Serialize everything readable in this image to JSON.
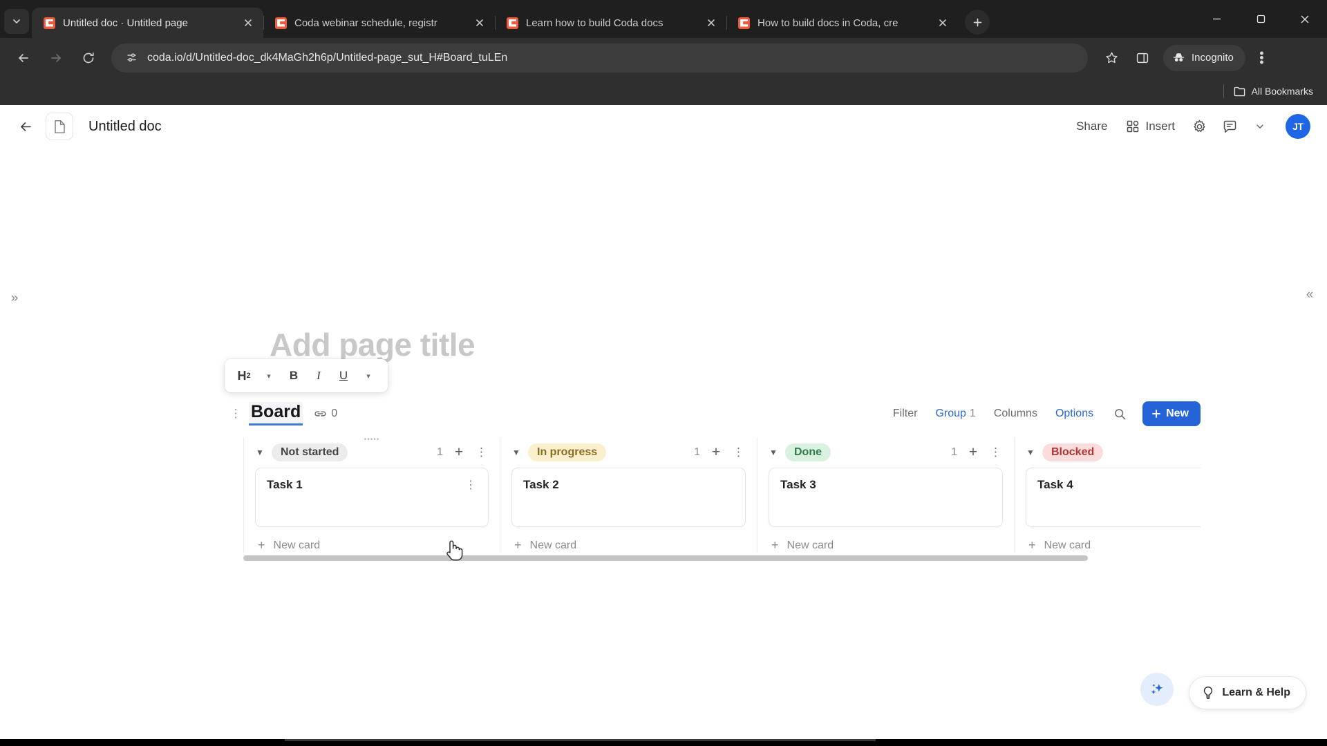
{
  "browser": {
    "tabs": [
      {
        "title": "Untitled doc · Untitled page",
        "active": true
      },
      {
        "title": "Coda webinar schedule, registr",
        "active": false
      },
      {
        "title": "Learn how to build Coda docs",
        "active": false
      },
      {
        "title": "How to build docs in Coda, cre",
        "active": false
      }
    ],
    "omnibox": {
      "url": "coda.io/d/Untitled-doc_dk4MaGh2h6p/Untitled-page_sut_H#Board_tuLEn"
    },
    "profile_label": "Incognito",
    "bookmarks": {
      "all_bookmarks_label": "All Bookmarks"
    }
  },
  "doc": {
    "title": "Untitled doc",
    "share_label": "Share",
    "insert_label": "Insert",
    "avatar_initials": "JT",
    "page_title_placeholder": "Add page title"
  },
  "format_toolbar": {
    "heading": "H",
    "heading_level": "2",
    "bold": "B",
    "italic": "I",
    "underline": "U"
  },
  "board": {
    "name": "Board",
    "link_count": "0",
    "toolbar": {
      "filter": "Filter",
      "group": "Group",
      "group_count": "1",
      "columns": "Columns",
      "options": "Options",
      "new_button": "New"
    },
    "accent_color": "#2563d9",
    "columns": [
      {
        "label": "Not started",
        "chip_class": "chip-grey",
        "count": "1",
        "cards": [
          {
            "title": "Task 1"
          }
        ],
        "new_card_label": "New card"
      },
      {
        "label": "In progress",
        "chip_class": "chip-yellow",
        "count": "1",
        "cards": [
          {
            "title": "Task 2"
          }
        ],
        "new_card_label": "New card"
      },
      {
        "label": "Done",
        "chip_class": "chip-green",
        "count": "1",
        "cards": [
          {
            "title": "Task 3"
          }
        ],
        "new_card_label": "New card"
      },
      {
        "label": "Blocked",
        "chip_class": "chip-red",
        "count": "",
        "cards": [
          {
            "title": "Task 4"
          }
        ],
        "new_card_label": "New card"
      }
    ]
  },
  "footer": {
    "help_label": "Learn & Help"
  }
}
